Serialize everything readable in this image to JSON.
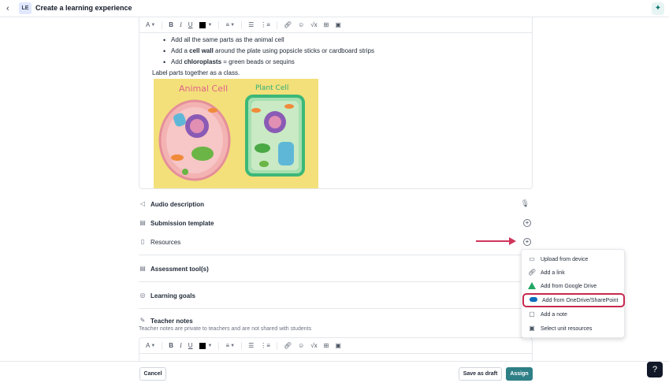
{
  "header": {
    "back_icon": "chevron-left-icon",
    "badge": "LE",
    "title": "Create a learning experience",
    "assistant_icon": "sparkle-icon"
  },
  "toolbar": {
    "font_size": "A",
    "bold": "B",
    "italic": "I",
    "underline": "U",
    "text_color": "#000000"
  },
  "content": {
    "bullet1": "Add all the same parts as the animal cell",
    "bullet2_pre": "Add a ",
    "bullet2_bold": "cell wall",
    "bullet2_post": " around the plate using popsicle sticks or cardboard strips",
    "bullet3_pre": "Add ",
    "bullet3_bold": "chloroplasts",
    "bullet3_post": " = green beads or sequins",
    "para": "Label parts together as a class.",
    "image": {
      "label_left": "Animal Cell",
      "label_right": "Plant Cell"
    }
  },
  "sections": {
    "audio": "Audio description",
    "submission": "Submission template",
    "resources": "Resources",
    "assessment": "Assessment tool(s)",
    "goals": "Learning goals",
    "notes": "Teacher notes",
    "notes_sub": "Teacher notes are private to teachers and are not shared with students"
  },
  "menu": {
    "items": [
      {
        "label": "Upload from device",
        "icon": "monitor-icon"
      },
      {
        "label": "Add a link",
        "icon": "link-icon"
      },
      {
        "label": "Add from Google Drive",
        "icon": "google-drive-icon"
      },
      {
        "label": "Add from OneDrive/SharePoint",
        "icon": "onedrive-icon"
      },
      {
        "label": "Add a note",
        "icon": "note-icon"
      },
      {
        "label": "Select unit resources",
        "icon": "briefcase-icon"
      }
    ]
  },
  "footer": {
    "cancel": "Cancel",
    "save_draft": "Save as draft",
    "assign": "Assign",
    "help": "?"
  },
  "colors": {
    "accent": "#2f7f86",
    "highlight": "#c8284f",
    "arrow": "#d0355a"
  }
}
